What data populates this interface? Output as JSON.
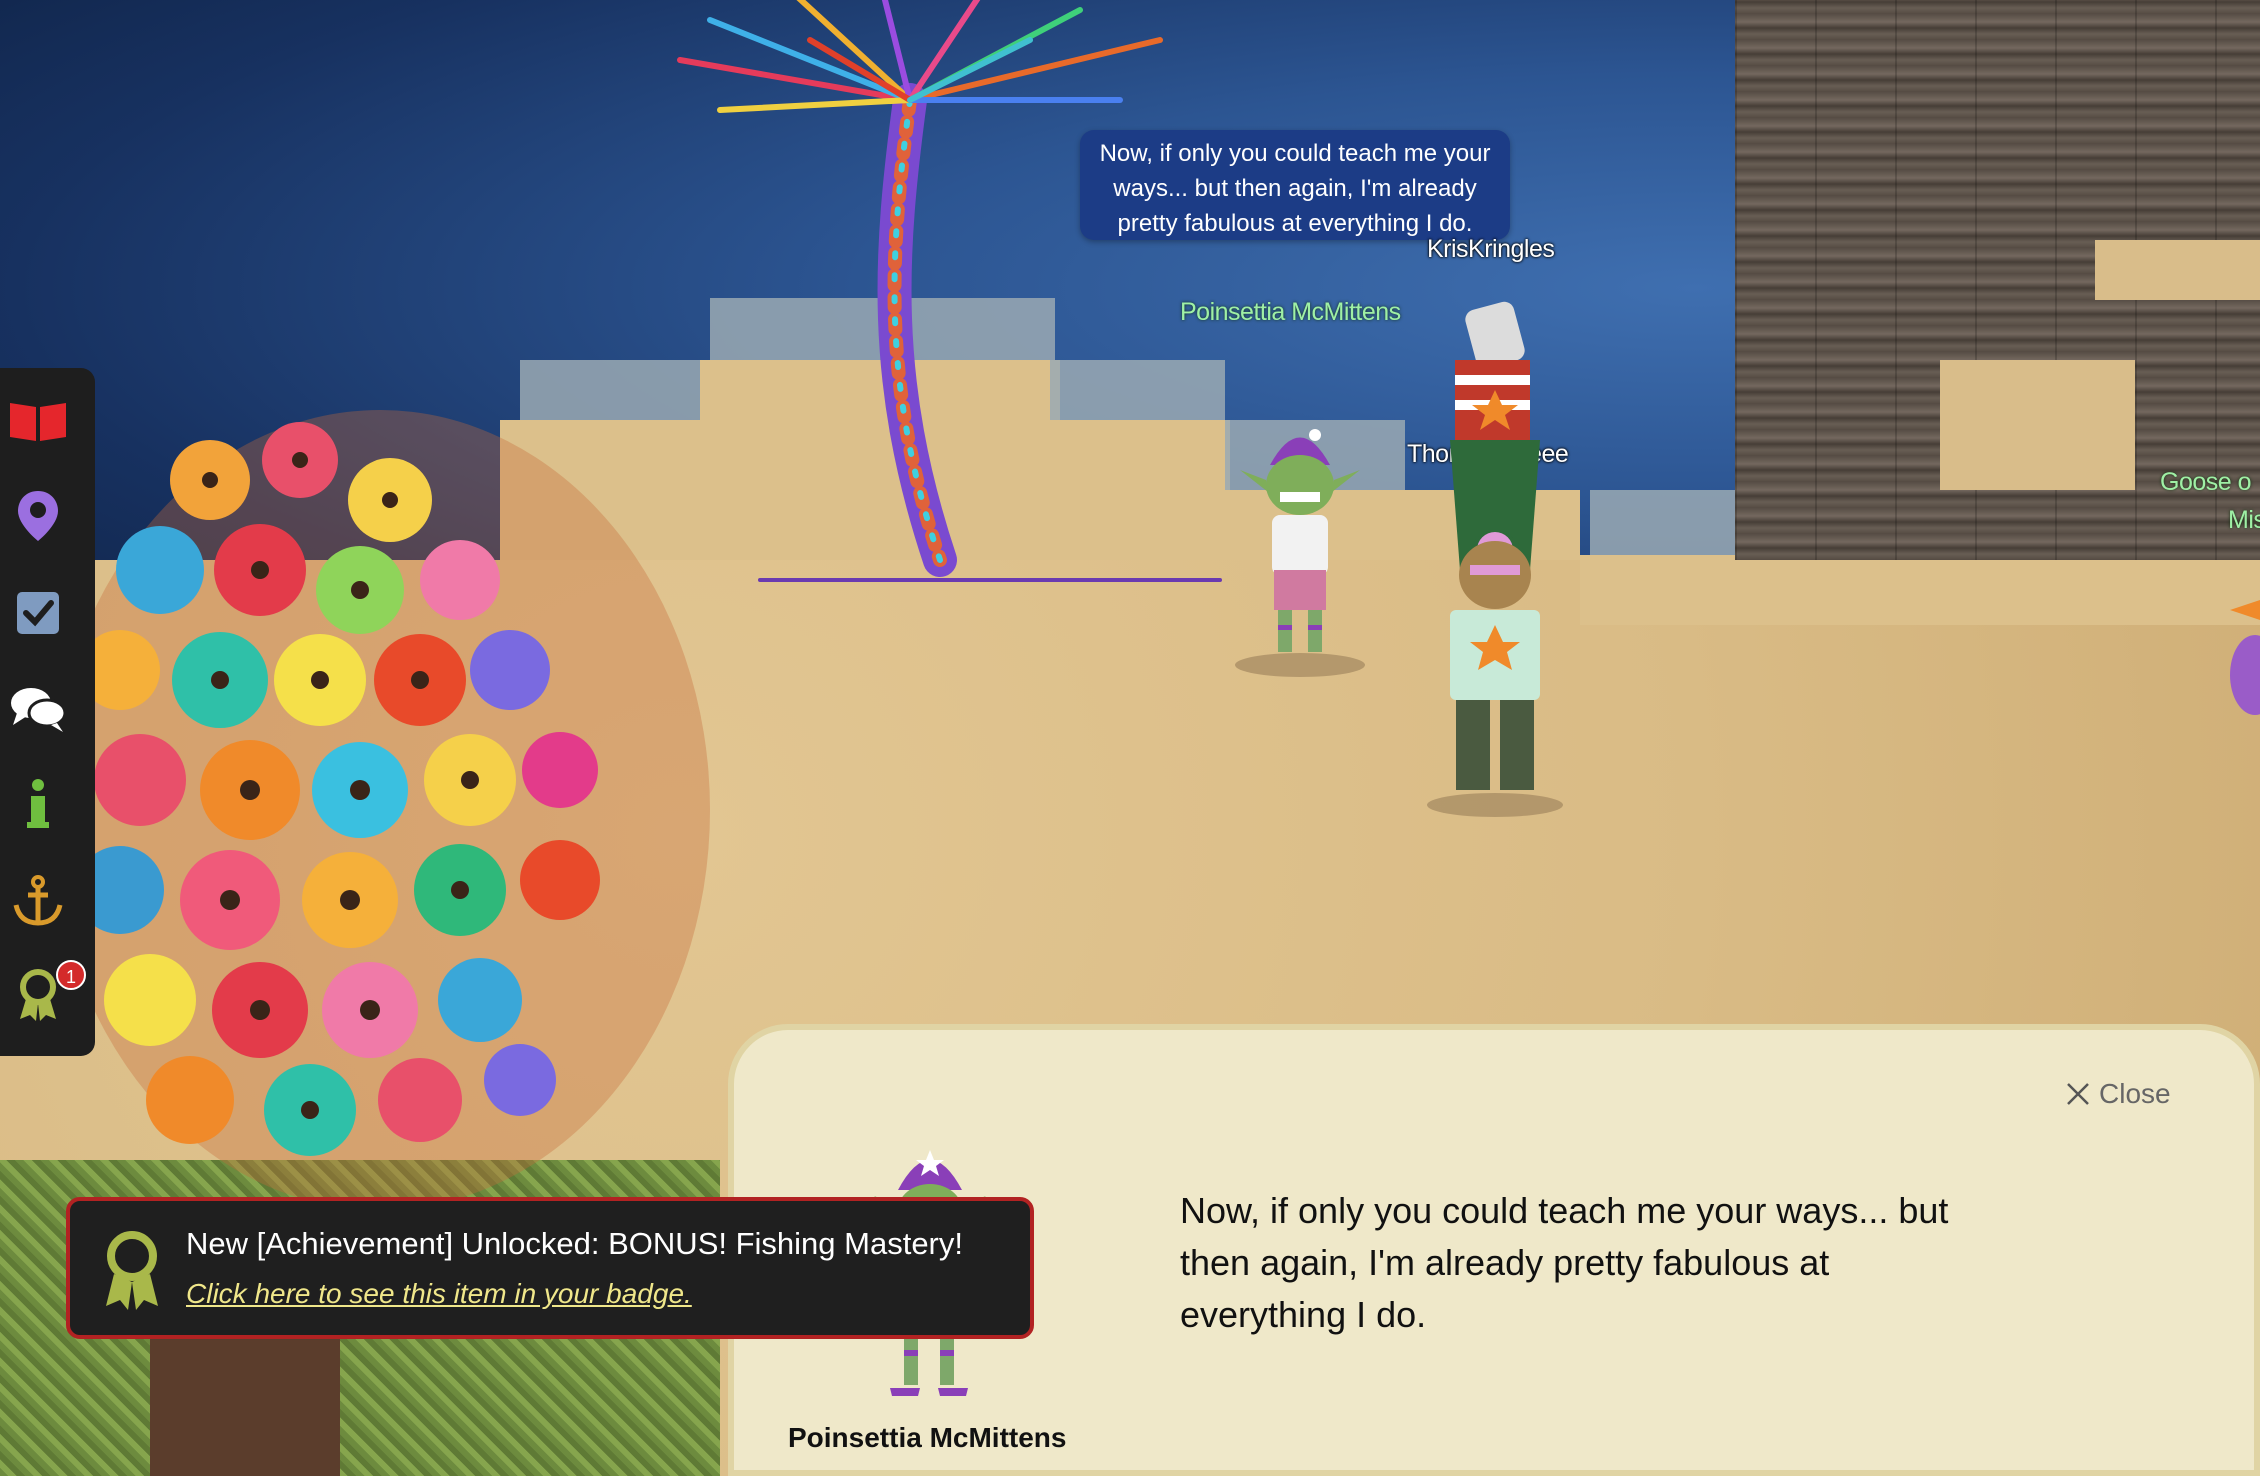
{
  "speech_bubble": {
    "text": "Now, if only you could teach me your ways... but then again, I'm already pretty fabulous at everything I do."
  },
  "players": {
    "kriskringles": "KrisKringles",
    "poinsettia": "Poinsettia McMittens",
    "thomas": "Thomasmeeee",
    "goose_line1": "Goose o",
    "goose_line2": "Mis"
  },
  "sidebar": {
    "items": [
      {
        "icon": "book-icon",
        "label": "Book"
      },
      {
        "icon": "map-pin-icon",
        "label": "Map"
      },
      {
        "icon": "checklist-icon",
        "label": "Objectives"
      },
      {
        "icon": "chat-icon",
        "label": "Chat"
      },
      {
        "icon": "info-icon",
        "label": "Info"
      },
      {
        "icon": "anchor-icon",
        "label": "Anchor"
      },
      {
        "icon": "badge-icon",
        "label": "Badge"
      }
    ],
    "badge_count": "1",
    "colors": {
      "book": "#e5262c",
      "pin": "#9b6fe0",
      "check": "#7f9bc0",
      "chat": "#ffffff",
      "info": "#6fbf3f",
      "anchor": "#d99a2b",
      "badge": "#a9b84a"
    }
  },
  "dialog": {
    "close_label": "Close",
    "text_lines": [
      "Now, if only you could teach me your ways... but",
      "then again, I'm already pretty fabulous at",
      "everything I do."
    ],
    "speaker_name": "Poinsettia McMittens"
  },
  "toast": {
    "title": "New [Achievement] Unlocked: BONUS! Fishing Mastery!",
    "link": "Click here to see this item in your badge."
  }
}
